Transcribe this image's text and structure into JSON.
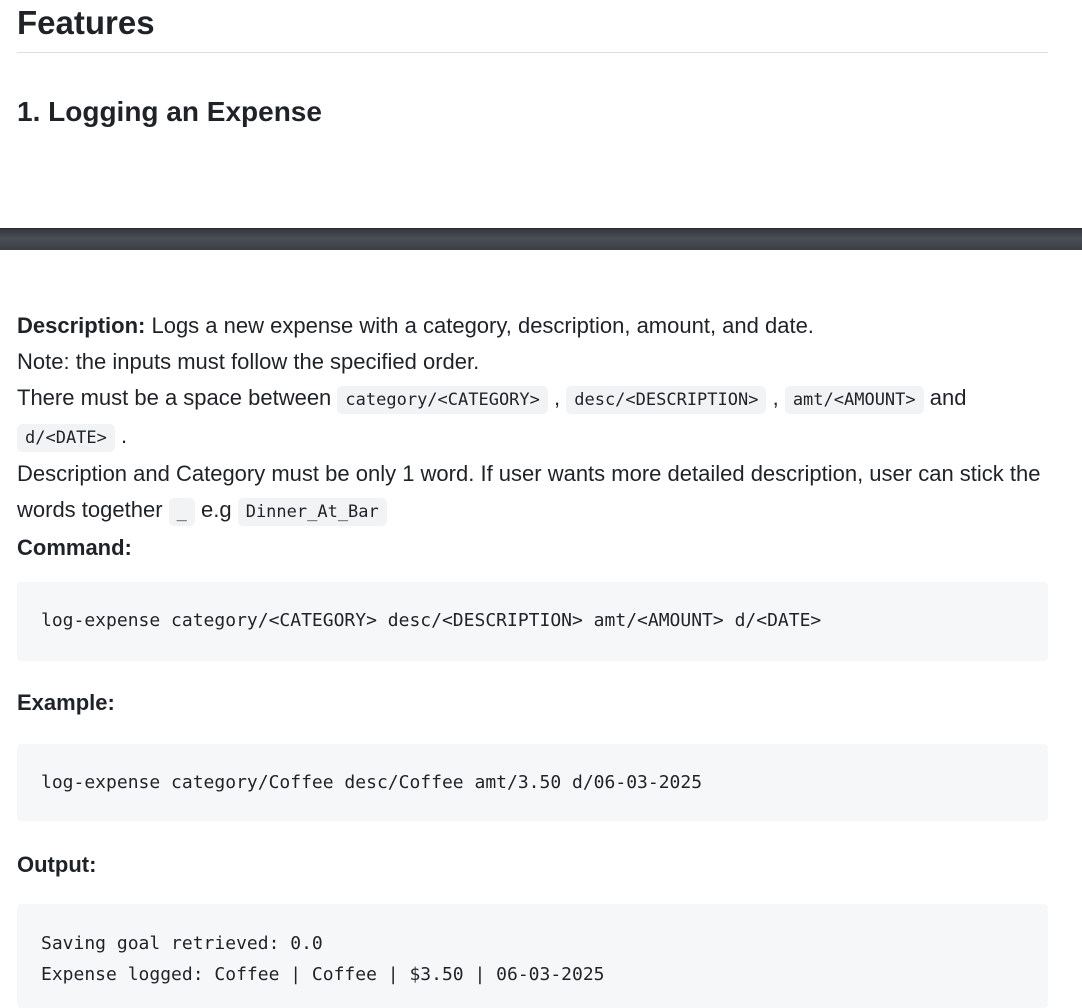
{
  "heading": "Features",
  "section_title": "1. Logging an Expense",
  "description": {
    "label": "Description:",
    "text": " Logs a new expense with a category, description, amount, and date."
  },
  "note": "Note: the inputs must follow the specified order.",
  "spacing_line": {
    "prefix": "There must be a space between ",
    "code1": "category/<CATEGORY>",
    "sep1": " , ",
    "code2": "desc/<DESCRIPTION>",
    "sep2": " , ",
    "code3": "amt/<AMOUNT>",
    "sep3": " and",
    "code4": "d/<DATE>",
    "end": " ."
  },
  "word_rule": {
    "text1": "Description and Category must be only 1 word. If user wants more detailed description, user can stick the words together ",
    "code_underscore": "_",
    "text2": " e.g ",
    "code_example": "Dinner_At_Bar"
  },
  "command_label": "Command:",
  "command_code": "log-expense category/<CATEGORY> desc/<DESCRIPTION> amt/<AMOUNT> d/<DATE>",
  "example_label": "Example:",
  "example_code": "log-expense category/Coffee desc/Coffee amt/3.50 d/06-03-2025",
  "output_label": "Output:",
  "output_lines": [
    "Saving goal retrieved: 0.0",
    "Expense logged: Coffee | Coffee | $3.50 | 06-03-2025"
  ]
}
